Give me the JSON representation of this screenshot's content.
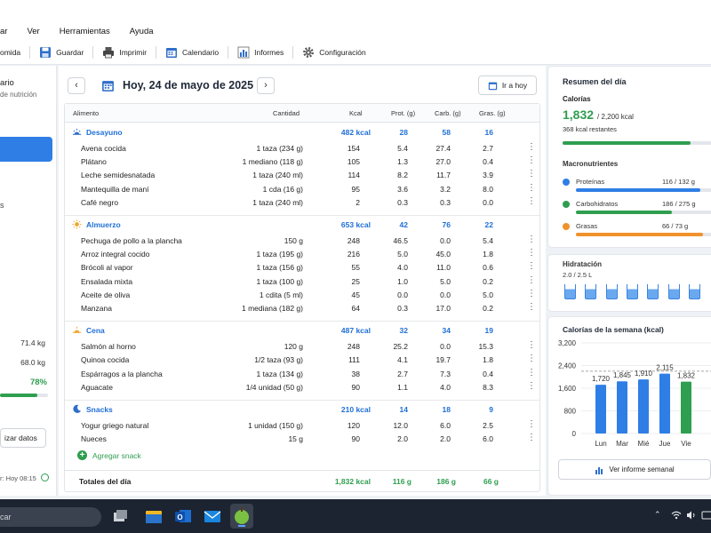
{
  "menu": [
    "ar",
    "Ver",
    "Herramientas",
    "Ayuda"
  ],
  "toolbar": {
    "items": [
      "omida",
      "Guardar",
      "Imprimir",
      "Calendario",
      "Informes",
      "Configuración"
    ]
  },
  "left": {
    "title": "ario",
    "subtitle": "de nutrición",
    "s_label": "s",
    "weight1": "71.4 kg",
    "weight2": "68.0 kg",
    "progress_label": "78%",
    "progress_value": 0.78,
    "sync_button": "izar datos",
    "footer": "r: Hoy 08:15"
  },
  "date": {
    "title": "Hoy, 24 de mayo de 2025",
    "prev": "‹",
    "next": "›",
    "today_button": "Ir a hoy"
  },
  "table": {
    "headers": [
      "Alimento",
      "Cantidad",
      "Kcal",
      "Prot. (g)",
      "Carb. (g)",
      "Gras. (g)"
    ],
    "meals": [
      {
        "name": "Desayuno",
        "kcal": "482 kcal",
        "prot": "28",
        "carb": "58",
        "fat": "16",
        "items": [
          [
            "Avena cocida",
            "1 taza (234 g)",
            "154",
            "5.4",
            "27.4",
            "2.7"
          ],
          [
            "Plátano",
            "1 mediano (118 g)",
            "105",
            "1.3",
            "27.0",
            "0.4"
          ],
          [
            "Leche semidesnatada",
            "1 taza (240 ml)",
            "114",
            "8.2",
            "11.7",
            "3.9"
          ],
          [
            "Mantequilla de maní",
            "1 cda (16 g)",
            "95",
            "3.6",
            "3.2",
            "8.0"
          ],
          [
            "Café negro",
            "1 taza (240 ml)",
            "2",
            "0.3",
            "0.3",
            "0.0"
          ]
        ]
      },
      {
        "name": "Almuerzo",
        "kcal": "653 kcal",
        "prot": "42",
        "carb": "76",
        "fat": "22",
        "items": [
          [
            "Pechuga de pollo a la plancha",
            "150 g",
            "248",
            "46.5",
            "0.0",
            "5.4"
          ],
          [
            "Arroz integral cocido",
            "1 taza (195 g)",
            "216",
            "5.0",
            "45.0",
            "1.8"
          ],
          [
            "Brócoli al vapor",
            "1 taza (156 g)",
            "55",
            "4.0",
            "11.0",
            "0.6"
          ],
          [
            "Ensalada mixta",
            "1 taza (100 g)",
            "25",
            "1.0",
            "5.0",
            "0.2"
          ],
          [
            "Aceite de oliva",
            "1 cdita (5 ml)",
            "45",
            "0.0",
            "0.0",
            "5.0"
          ],
          [
            "Manzana",
            "1 mediana (182 g)",
            "64",
            "0.3",
            "17.0",
            "0.2"
          ]
        ]
      },
      {
        "name": "Cena",
        "kcal": "487 kcal",
        "prot": "32",
        "carb": "34",
        "fat": "19",
        "items": [
          [
            "Salmón al horno",
            "120 g",
            "248",
            "25.2",
            "0.0",
            "15.3"
          ],
          [
            "Quinoa cocida",
            "1/2 taza (93 g)",
            "111",
            "4.1",
            "19.7",
            "1.8"
          ],
          [
            "Espárragos a la plancha",
            "1 taza (134 g)",
            "38",
            "2.7",
            "7.3",
            "0.4"
          ],
          [
            "Aguacate",
            "1/4 unidad (50 g)",
            "90",
            "1.1",
            "4.0",
            "8.3"
          ]
        ]
      },
      {
        "name": "Snacks",
        "kcal": "210 kcal",
        "prot": "14",
        "carb": "18",
        "fat": "9",
        "items": [
          [
            "Yogur griego natural",
            "1 unidad (150 g)",
            "120",
            "12.0",
            "6.0",
            "2.5"
          ],
          [
            "Nueces",
            "15 g",
            "90",
            "2.0",
            "2.0",
            "6.0"
          ]
        ]
      }
    ],
    "add_snack": "Agregar snack",
    "totals": {
      "label": "Totales del día",
      "kcal": "1,832 kcal",
      "prot": "116 g",
      "carb": "186 g",
      "fat": "66 g"
    }
  },
  "summary": {
    "title": "Resumen del día",
    "cal_label": "Calorías",
    "cal_value": "1,832",
    "cal_goal": "/ 2,200 kcal",
    "cal_remaining": "368 kcal restantes",
    "cal_progress": 0.83,
    "macros_title": "Macronutrientes",
    "macros": [
      {
        "name": "Proteínas",
        "value": "116 / 132 g",
        "progress": 0.88,
        "color": "#2f7ee6"
      },
      {
        "name": "Carbohidratos",
        "value": "186 / 275 g",
        "progress": 0.68,
        "color": "#2e9e4f"
      },
      {
        "name": "Grasas",
        "value": "66 / 73 g",
        "progress": 0.9,
        "color": "#f0922b"
      }
    ],
    "hydration_title": "Hidratación",
    "hydration_value": "2.0 / 2.5 L"
  },
  "week": {
    "title": "Calorías de la semana (kcal)",
    "button": "Ver informe semanal",
    "accent": "#2f7ee6",
    "today_color": "#2e9e4f"
  },
  "chart_data": {
    "type": "bar",
    "categories": [
      "Lun",
      "Mar",
      "Mié",
      "Jue",
      "Vie"
    ],
    "values": [
      1720,
      1845,
      1910,
      2115,
      1832
    ],
    "value_labels": [
      "1,720",
      "1,845",
      "1,910",
      "2,115",
      "1,832"
    ],
    "yticks": [
      "3,200",
      "2,400",
      "1,600",
      "800",
      "0"
    ],
    "ylim": [
      0,
      3200
    ],
    "goal_line": 2200
  },
  "taskbar": {
    "search": "car"
  }
}
